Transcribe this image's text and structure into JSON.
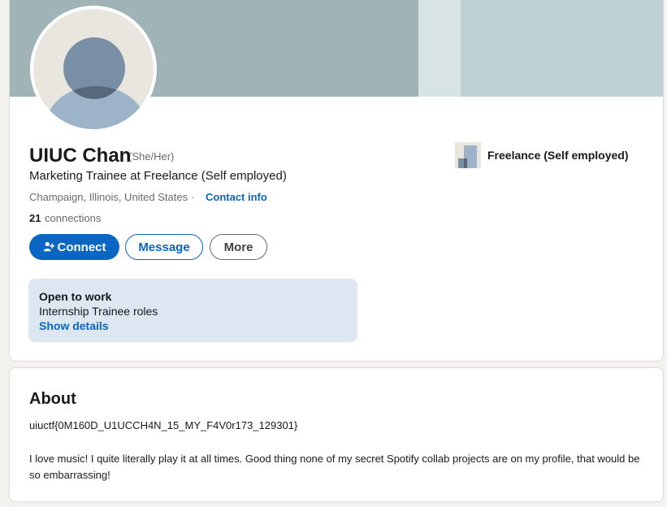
{
  "profile": {
    "name": "UIUC Chan",
    "pronouns": "(She/Her)",
    "headline": "Marketing Trainee at Freelance (Self employed)",
    "location": "Champaign, Illinois, United States ·",
    "contact_info": "Contact info",
    "connections_count": "21",
    "connections_label": "connections",
    "avatar_icon": "default-person-avatar"
  },
  "actions": {
    "connect": "Connect",
    "message": "Message",
    "more": "More"
  },
  "open_to_work": {
    "title": "Open to work",
    "roles": "Internship Trainee roles",
    "show_details": "Show details"
  },
  "experience": {
    "company": "Freelance (Self employed)",
    "logo_icon": "company-logo"
  },
  "about": {
    "title": "About",
    "flag": "uiuctf{0M160D_U1UCCH4N_15_MY_F4V0r173_129301}",
    "text": "I love music! I quite literally play it at all times. Good thing none of my secret Spotify collab projects are on my profile, that would be so embarrassing!"
  },
  "colors": {
    "accent": "#0a66c2",
    "banner": "#a0b4b7",
    "open_to_work_bg": "#dde7f1",
    "page_bg": "#f4f2ee"
  }
}
